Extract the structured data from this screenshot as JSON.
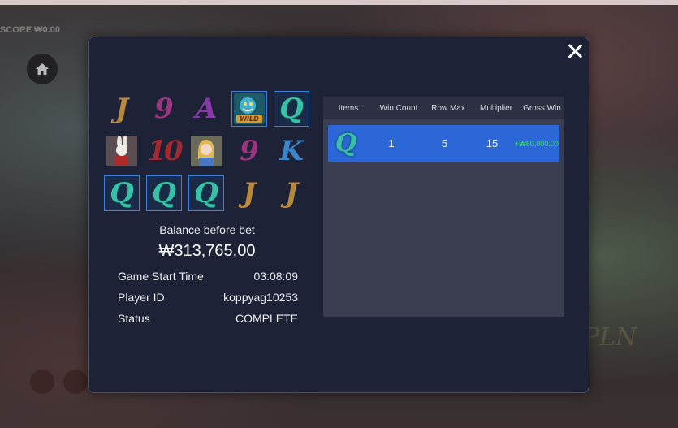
{
  "background": {
    "score_text": "SCORE  ₩0.00"
  },
  "reels": [
    [
      {
        "id": "J",
        "text": "J",
        "highlight": false
      },
      {
        "id": "9",
        "text": "9",
        "highlight": false
      },
      {
        "id": "A",
        "text": "A",
        "highlight": false
      },
      {
        "id": "wild-cat",
        "text": "WILD",
        "highlight": true
      },
      {
        "id": "Q",
        "text": "Q",
        "highlight": true
      }
    ],
    [
      {
        "id": "white-rabbit",
        "text": "",
        "highlight": false
      },
      {
        "id": "10",
        "text": "10",
        "highlight": false
      },
      {
        "id": "alice",
        "text": "",
        "highlight": false
      },
      {
        "id": "9",
        "text": "9",
        "highlight": false
      },
      {
        "id": "K",
        "text": "K",
        "highlight": false
      }
    ],
    [
      {
        "id": "Q",
        "text": "Q",
        "highlight": true
      },
      {
        "id": "Q",
        "text": "Q",
        "highlight": true
      },
      {
        "id": "Q",
        "text": "Q",
        "highlight": true
      },
      {
        "id": "J",
        "text": "J",
        "highlight": false
      },
      {
        "id": "J",
        "text": "J",
        "highlight": false
      }
    ]
  ],
  "balance": {
    "label": "Balance before bet",
    "value": "₩313,765.00"
  },
  "info": {
    "start_time_label": "Game Start Time",
    "start_time_value": "03:08:09",
    "player_label": "Player ID",
    "player_value": "koppyag10253",
    "status_label": "Status",
    "status_value": "COMPLETE"
  },
  "table": {
    "headers": [
      "Items",
      "Win Count",
      "Row Max",
      "Multiplier",
      "Gross Win"
    ],
    "rows": [
      {
        "item": "Q",
        "win_count": "1",
        "row_max": "5",
        "multiplier": "15",
        "gross_win": "+₩60,000.00"
      }
    ]
  },
  "colors": {
    "modal_bg": "#1e2236",
    "selected_row": "#2b67d6",
    "win_green": "#38e058",
    "highlight_border": "#3f7fd6"
  }
}
